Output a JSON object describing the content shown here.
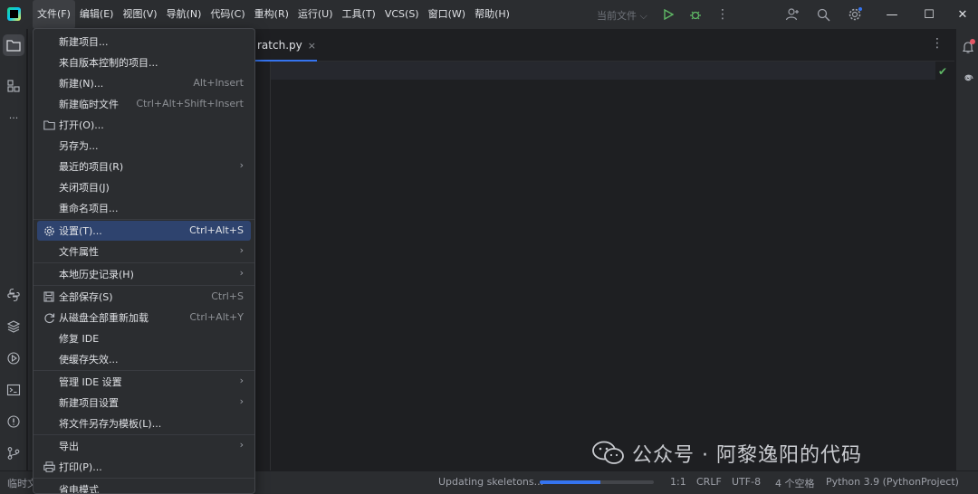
{
  "menubar": [
    "文件(F)",
    "编辑(E)",
    "视图(V)",
    "导航(N)",
    "代码(C)",
    "重构(R)",
    "运行(U)",
    "工具(T)",
    "VCS(S)",
    "窗口(W)",
    "帮助(H)"
  ],
  "run_config": "当前文件 ⌵",
  "editor": {
    "tab_label": "ratch.py",
    "tab_close": "×"
  },
  "file_menu": [
    {
      "label": "新建项目...",
      "shortcut": ""
    },
    {
      "label": "来自版本控制的项目...",
      "shortcut": ""
    },
    {
      "label": "新建(N)...",
      "shortcut": "Alt+Insert"
    },
    {
      "label": "新建临时文件",
      "shortcut": "Ctrl+Alt+Shift+Insert"
    },
    {
      "label": "打开(O)...",
      "shortcut": "",
      "icon": "folder-icon"
    },
    {
      "label": "另存为...",
      "shortcut": ""
    },
    {
      "label": "最近的项目(R)",
      "shortcut": "",
      "submenu": true
    },
    {
      "label": "关闭项目(J)",
      "shortcut": ""
    },
    {
      "label": "重命名项目...",
      "shortcut": ""
    },
    {
      "label": "设置(T)...",
      "shortcut": "Ctrl+Alt+S",
      "icon": "gear-icon",
      "highlighted": true
    },
    {
      "label": "文件属性",
      "shortcut": "",
      "submenu": true
    },
    {
      "label": "本地历史记录(H)",
      "shortcut": "",
      "submenu": true
    },
    {
      "label": "全部保存(S)",
      "shortcut": "Ctrl+S",
      "icon": "save-icon"
    },
    {
      "label": "从磁盘全部重新加载",
      "shortcut": "Ctrl+Alt+Y",
      "icon": "reload-icon"
    },
    {
      "label": "修复 IDE",
      "shortcut": ""
    },
    {
      "label": "使缓存失效...",
      "shortcut": ""
    },
    {
      "label": "管理 IDE 设置",
      "shortcut": "",
      "submenu": true
    },
    {
      "label": "新建项目设置",
      "shortcut": "",
      "submenu": true
    },
    {
      "label": "将文件另存为模板(L)...",
      "shortcut": ""
    },
    {
      "label": "导出",
      "shortcut": "",
      "submenu": true
    },
    {
      "label": "打印(P)...",
      "shortcut": "",
      "icon": "print-icon"
    },
    {
      "label": "省电模式",
      "shortcut": ""
    }
  ],
  "submenu_arrow": "›",
  "statusbar": {
    "left_text": "临时文",
    "task": "Updating skeletons...",
    "progress": 0.53,
    "position": "1:1",
    "line_sep": "CRLF",
    "encoding": "UTF-8",
    "indent": "4 个空格",
    "interpreter": "Python 3.9 (PythonProject)"
  },
  "watermark": "公众号 · 阿黎逸阳的代码",
  "colors": {
    "accent": "#3574f0",
    "highlight": "#2e436e",
    "run_green": "#5fb865"
  }
}
